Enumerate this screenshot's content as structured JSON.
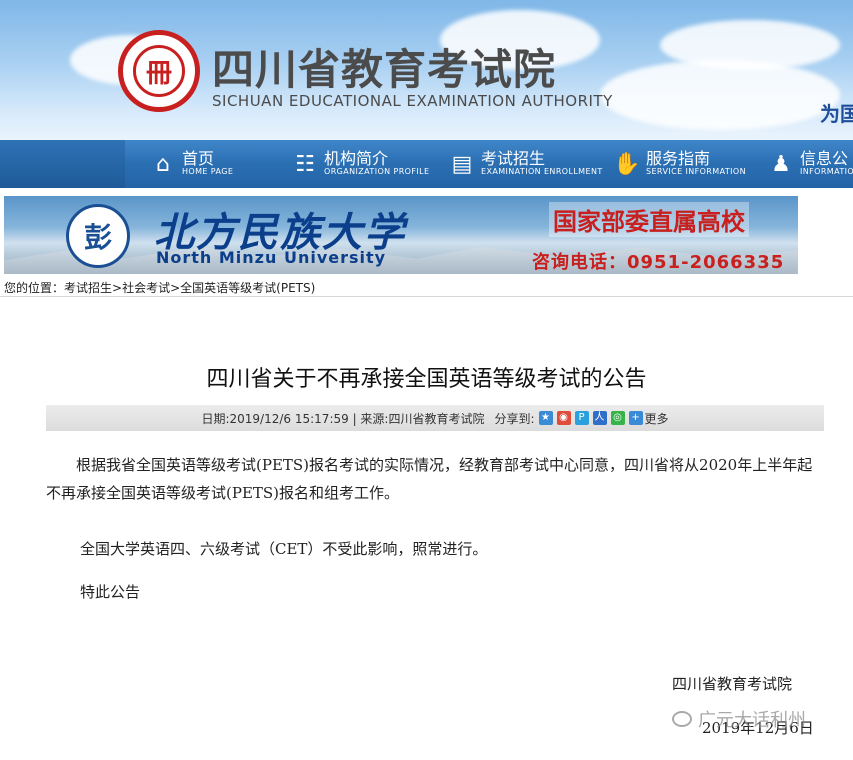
{
  "header": {
    "site_name_cn": "四川省教育考试院",
    "site_name_en": "SICHUAN EDUCATIONAL EXAMINATION AUTHORITY",
    "slogan": "为国"
  },
  "nav": [
    {
      "cn": "首页",
      "en": "HOME PAGE",
      "icon": "home-icon"
    },
    {
      "cn": "机构简介",
      "en": "ORGANIZATION PROFILE",
      "icon": "org-icon"
    },
    {
      "cn": "考试招生",
      "en": "EXAMINATION ENROLLMENT",
      "icon": "document-icon"
    },
    {
      "cn": "服务指南",
      "en": "SERVICE INFORMATION",
      "icon": "handshake-icon"
    },
    {
      "cn": "信息公",
      "en": "INFORMATIO",
      "icon": "people-icon"
    }
  ],
  "ad": {
    "name_cn": "北方民族大学",
    "name_en": "North Minzu University",
    "tag": "国家部委直属高校",
    "phone": "咨询电话：0951-2066335"
  },
  "breadcrumb": {
    "prefix": "您的位置：",
    "items": [
      "考试招生",
      "社会考试",
      "全国英语等级考试(PETS)"
    ],
    "separator": ">"
  },
  "article": {
    "title": "四川省关于不再承接全国英语等级考试的公告",
    "meta": "日期:2019/12/6 15:17:59 | 来源:四川省教育考试院",
    "share_label": "分享到:",
    "more_label": "更多",
    "paragraphs": [
      "根据我省全国英语等级考试(PETS)报名考试的实际情况，经教育部考试中心同意，四川省将从2020年上半年起不再承接全国英语等级考试(PETS)报名和组考工作。",
      "全国大学英语四、六级考试（CET）不受此影响，照常进行。",
      "特此公告"
    ],
    "signature_org": "四川省教育考试院",
    "signature_date": "2019年12月6日"
  },
  "watermark": "广元大话利州",
  "colors": {
    "nav_bg": "#2b6fb3",
    "accent_red": "#c8201e",
    "meta_bar": "#e3e3e3"
  }
}
